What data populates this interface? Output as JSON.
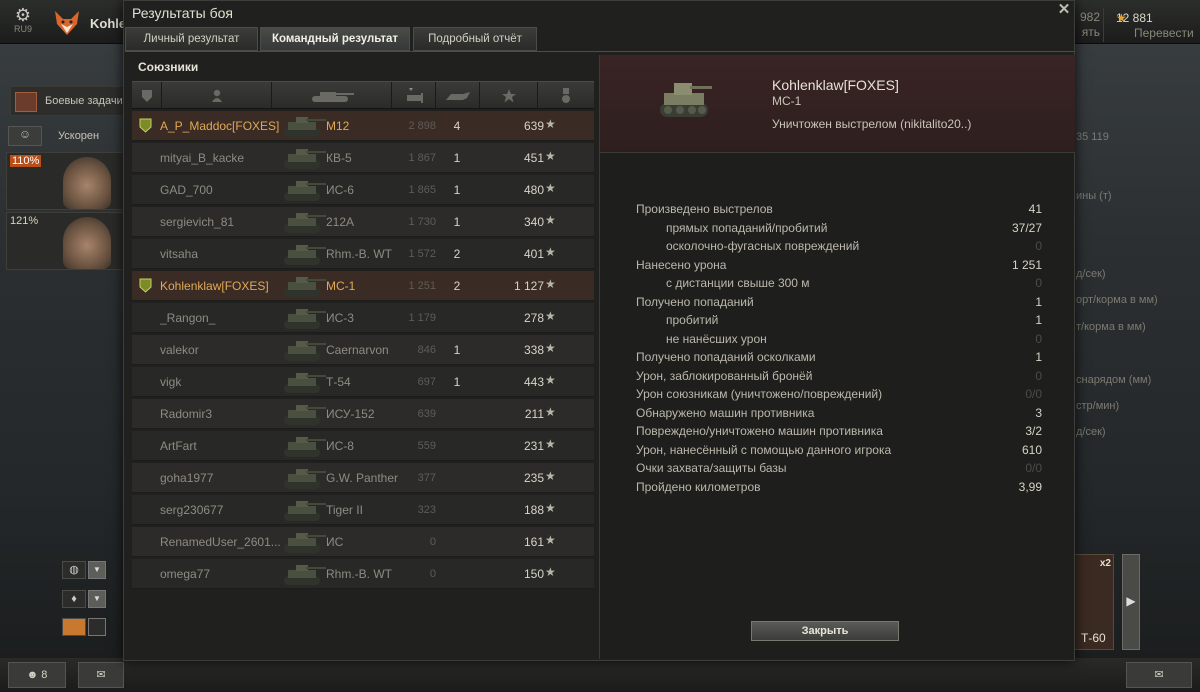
{
  "topbar": {
    "settings_label": "RU9",
    "player_name": "Kohle",
    "partial_value": "982",
    "partial_label": "ять",
    "gold_amount": "12 881",
    "gold_label": "Перевести"
  },
  "left_panel": {
    "tasks_label": "Боевые задачи",
    "accelerate_label": "Ускорен",
    "crew_1_pct": "110%",
    "crew_2_pct": "121%"
  },
  "bottom_bar": {
    "friends_count": "8"
  },
  "reserve": {
    "multiplier": "x2",
    "vehicle_name": "Т-60"
  },
  "bg_stats": [
    "35 119",
    "ины (т)",
    "д/сек)",
    "орт/корма в мм)",
    "т/корма в мм)",
    "снарядом (мм)",
    "стр/мин)",
    "д/сек)"
  ],
  "dialog": {
    "title": "Результаты боя",
    "close_icon": "close-icon",
    "tabs": [
      {
        "label": "Личный результат",
        "active": false
      },
      {
        "label": "Командный результат",
        "active": true
      },
      {
        "label": "Подробный отчёт",
        "active": false
      }
    ]
  },
  "allies": {
    "title": "Союзники",
    "columns": [
      "squad-icon",
      "player-icon",
      "tank-icon",
      "damage-icon",
      "kills-icon",
      "xp-icon",
      "medal-icon"
    ],
    "rows": [
      {
        "player": "A_P_Maddoc[FOXES]",
        "tank": "M12",
        "damage": "2 898",
        "kills": "4",
        "xp": "639",
        "squad": true,
        "highlight": true,
        "me": false
      },
      {
        "player": "mityai_B_kacke",
        "tank": "КВ-5",
        "damage": "1 867",
        "kills": "1",
        "xp": "451",
        "squad": false,
        "highlight": false,
        "me": false
      },
      {
        "player": "GAD_700",
        "tank": "ИС-6",
        "damage": "1 865",
        "kills": "1",
        "xp": "480",
        "squad": false,
        "highlight": false,
        "me": false
      },
      {
        "player": "sergievich_81",
        "tank": "212A",
        "damage": "1 730",
        "kills": "1",
        "xp": "340",
        "squad": false,
        "highlight": false,
        "me": false
      },
      {
        "player": "vitsaha",
        "tank": "Rhm.-B. WT",
        "damage": "1 572",
        "kills": "2",
        "xp": "401",
        "squad": false,
        "highlight": false,
        "me": false
      },
      {
        "player": "Kohlenklaw[FOXES]",
        "tank": "МС-1",
        "damage": "1 251",
        "kills": "2",
        "xp": "1 127",
        "squad": true,
        "highlight": true,
        "me": true
      },
      {
        "player": "_Rangon_",
        "tank": "ИС-3",
        "damage": "1 179",
        "kills": "",
        "xp": "278",
        "squad": false,
        "highlight": false,
        "me": false
      },
      {
        "player": "valekor",
        "tank": "Caernarvon",
        "damage": "846",
        "kills": "1",
        "xp": "338",
        "squad": false,
        "highlight": false,
        "me": false
      },
      {
        "player": "vigk",
        "tank": "Т-54",
        "damage": "697",
        "kills": "1",
        "xp": "443",
        "squad": false,
        "highlight": false,
        "me": false
      },
      {
        "player": "Radomir3",
        "tank": "ИСУ-152",
        "damage": "639",
        "kills": "",
        "xp": "211",
        "squad": false,
        "highlight": false,
        "me": false
      },
      {
        "player": "ArtFart",
        "tank": "ИС-8",
        "damage": "559",
        "kills": "",
        "xp": "231",
        "squad": false,
        "highlight": false,
        "me": false
      },
      {
        "player": "goha1977",
        "tank": "G.W. Panther",
        "damage": "377",
        "kills": "",
        "xp": "235",
        "squad": false,
        "highlight": false,
        "me": false
      },
      {
        "player": "serg230677",
        "tank": "Tiger II",
        "damage": "323",
        "kills": "",
        "xp": "188",
        "squad": false,
        "highlight": false,
        "me": false
      },
      {
        "player": "RenamedUser_2601...",
        "tank": "ИС",
        "damage": "0",
        "kills": "",
        "xp": "161",
        "squad": false,
        "highlight": false,
        "me": false
      },
      {
        "player": "omega77",
        "tank": "Rhm.-B. WT",
        "damage": "0",
        "kills": "",
        "xp": "150",
        "squad": false,
        "highlight": false,
        "me": false
      }
    ]
  },
  "details": {
    "player": "Kohlenklaw[FOXES]",
    "vehicle": "МС-1",
    "death": "Уничтожен выстрелом (nikitalito20..)",
    "stats": [
      {
        "label": "Произведено выстрелов",
        "value": "41",
        "sub": false,
        "dim": false
      },
      {
        "label": "прямых попаданий/пробитий",
        "value": "37/27",
        "sub": true,
        "dim": false
      },
      {
        "label": "осколочно-фугасных повреждений",
        "value": "0",
        "sub": true,
        "dim": true
      },
      {
        "label": "Нанесено урона",
        "value": "1 251",
        "sub": false,
        "dim": false
      },
      {
        "label": "с дистанции свыше 300 м",
        "value": "0",
        "sub": true,
        "dim": true
      },
      {
        "label": "Получено попаданий",
        "value": "1",
        "sub": false,
        "dim": false
      },
      {
        "label": "пробитий",
        "value": "1",
        "sub": true,
        "dim": false
      },
      {
        "label": "не нанёсших урон",
        "value": "0",
        "sub": true,
        "dim": true
      },
      {
        "label": "Получено попаданий осколками",
        "value": "1",
        "sub": false,
        "dim": false
      },
      {
        "label": "Урон, заблокированный бронёй",
        "value": "0",
        "sub": false,
        "dim": true
      },
      {
        "label": "Урон союзникам (уничтожено/повреждений)",
        "value": "0/0",
        "sub": false,
        "dim": true
      },
      {
        "label": "Обнаружено машин противника",
        "value": "3",
        "sub": false,
        "dim": false
      },
      {
        "label": "Повреждено/уничтожено машин противника",
        "value": "3/2",
        "sub": false,
        "dim": false
      },
      {
        "label": "Урон, нанесённый с помощью данного игрока",
        "value": "610",
        "sub": false,
        "dim": false
      },
      {
        "label": "Очки захвата/защиты базы",
        "value": "0/0",
        "sub": false,
        "dim": true
      },
      {
        "label": "Пройдено километров",
        "value": "3,99",
        "sub": false,
        "dim": false
      }
    ],
    "close_label": "Закрыть"
  },
  "colors": {
    "highlight_text": "#e1a957",
    "me_row": "#4a2b22",
    "gold_star": "#e8a42a"
  }
}
